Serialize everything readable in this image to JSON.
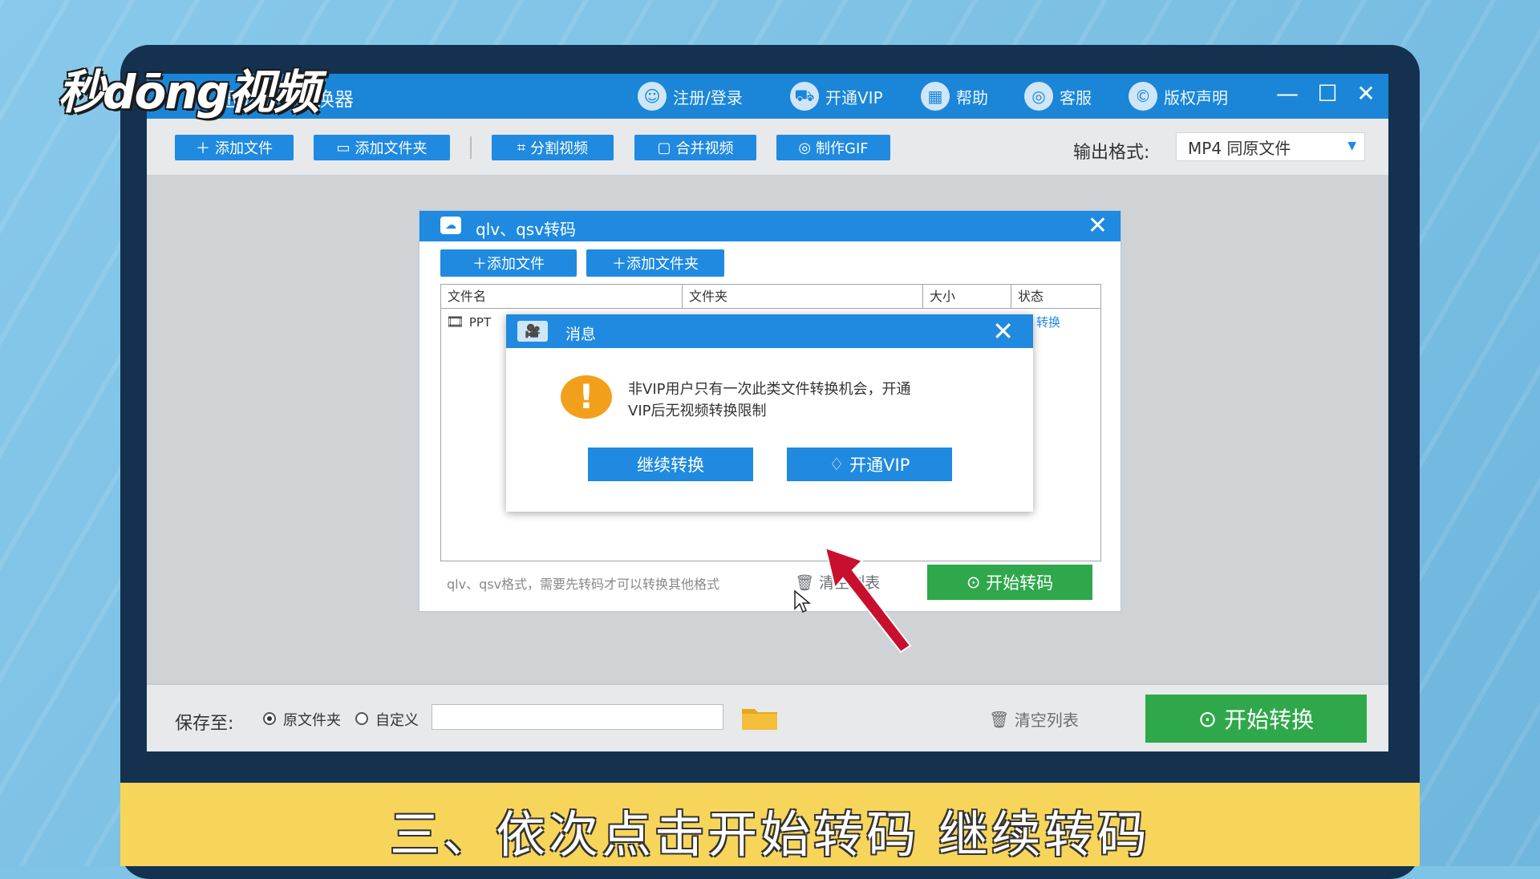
{
  "watermark": "秒dōng视频",
  "app": {
    "title": "迅捷视频转换器",
    "menu": [
      {
        "label": "注册/登录",
        "icon": "user-icon"
      },
      {
        "label": "开通VIP",
        "icon": "cart-icon"
      },
      {
        "label": "帮助",
        "icon": "grid-icon"
      },
      {
        "label": "客服",
        "icon": "headset-icon"
      },
      {
        "label": "版权声明",
        "icon": "copyright-icon"
      }
    ]
  },
  "toolbar": {
    "add_file": "添加文件",
    "add_folder": "添加文件夹",
    "split_video": "分割视频",
    "merge_video": "合并视频",
    "make_gif": "制作GIF",
    "output_label": "输出格式:",
    "output_value": "MP4  同原文件"
  },
  "bottom": {
    "save_label": "保存至:",
    "option_original": "原文件夹",
    "option_custom": "自定义",
    "path_value": "",
    "clear_list": "清空列表",
    "start_convert": "开始转换"
  },
  "qlv_dialog": {
    "title": "qlv、qsv转码",
    "add_file": "添加文件",
    "add_folder": "添加文件夹",
    "columns": [
      "文件名",
      "文件夹",
      "大小",
      "状态"
    ],
    "row": {
      "name": "PPT",
      "status": "转换"
    },
    "hint": "qlv、qsv格式，需要先转码才可以转换其他格式",
    "clear_list": "清空列表",
    "start_transcode": "开始转码"
  },
  "message": {
    "title": "消息",
    "text_line1": "非VIP用户只有一次此类文件转换机会，开通",
    "text_line2": "VIP后无视频转换限制",
    "continue": "继续转换",
    "open_vip": "开通VIP"
  },
  "caption": "三、依次点击开始转码   继续转码",
  "colors": {
    "primary": "#1f8ae0",
    "green": "#2fa84b",
    "caption_bg": "#f7d55a",
    "warn": "#f2a01b"
  }
}
